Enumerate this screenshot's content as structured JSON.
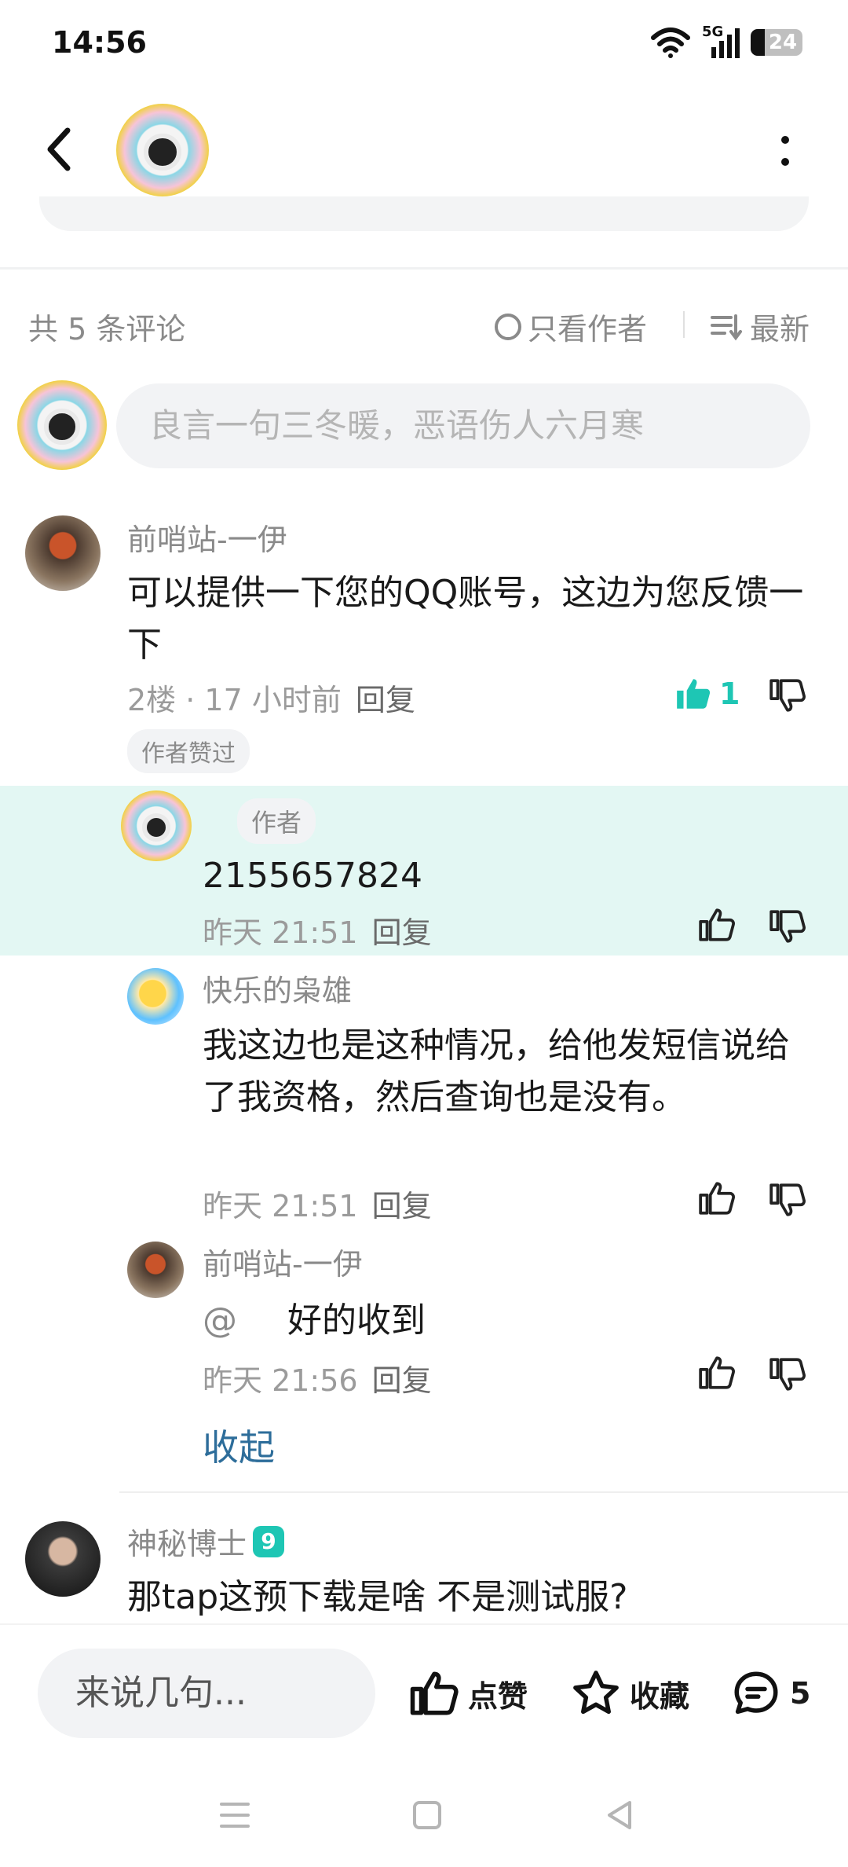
{
  "status_bar": {
    "time": "14:56",
    "network": "5G",
    "battery": "24"
  },
  "top_bar": {
    "back_icon": "chevron-left-icon",
    "more_icon": "more-vertical-icon"
  },
  "comments_header": {
    "count_text": "共 5 条评论",
    "only_author_label": "只看作者",
    "sort_label": "最新"
  },
  "comment_input": {
    "placeholder": "良言一句三冬暖，恶语伤人六月寒"
  },
  "comments": [
    {
      "username": "前哨站-一伊",
      "text": "可以提供一下您的QQ账号，这边为您反馈一下",
      "meta": "2楼 · 17 小时前",
      "reply_label": "回复",
      "like_count": "1",
      "badge": "作者赞过",
      "replies": [
        {
          "author_tag": "作者",
          "text": "2155657824",
          "time": "昨天 21:51",
          "reply_label": "回复",
          "highlighted": true
        },
        {
          "username": "快乐的枭雄",
          "text": "我这边也是这种情况，给他发短信说给了我资格，然后查询也是没有。",
          "time": "昨天 21:51",
          "reply_label": "回复"
        },
        {
          "username": "前哨站-一伊",
          "mention": "@",
          "text": "好的收到",
          "time": "昨天 21:56",
          "reply_label": "回复"
        }
      ],
      "collapse_label": "收起"
    },
    {
      "username": "神秘博士",
      "level": "9",
      "text": "那tap这预下载是啥 不是测试服?"
    }
  ],
  "bottom_bar": {
    "input_placeholder": "来说几句...",
    "like_label": "点赞",
    "favorite_label": "收藏",
    "comment_count": "5"
  },
  "colors": {
    "accent": "#1ec6b4",
    "highlight_bg": "#e3f7f3",
    "link": "#2d6d9a"
  }
}
